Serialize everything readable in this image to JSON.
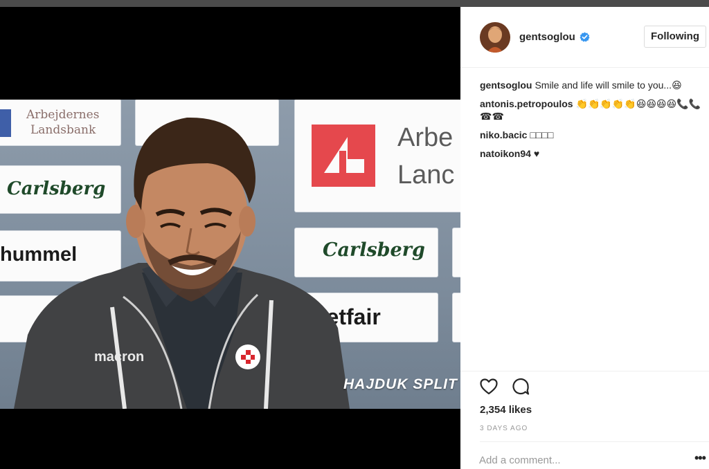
{
  "post": {
    "username": "gentsoglou",
    "follow_label": "Following",
    "likes_text": "2,354 likes",
    "date_text": "3 DAYS AGO",
    "comment_placeholder": "Add a comment...",
    "more_label": "•••"
  },
  "comments": [
    {
      "user": "gentsoglou",
      "text": "Smile and life will smile to you...😆"
    },
    {
      "user": "antonis.petropoulos",
      "text": "👏👏👏👏👏😆😆😆😆📞📞☎☎"
    },
    {
      "user": "niko.bacic",
      "text": "□□□□"
    },
    {
      "user": "natoikon94",
      "text": "♥"
    }
  ],
  "media": {
    "sponsor_1": "Arbejdernes",
    "sponsor_1b": "Landsbank",
    "sponsor_2": "Carlsberg",
    "sponsor_3": "hummel",
    "sponsor_4": "Arbe",
    "sponsor_4b": "Lanc",
    "sponsor_5": "Carlsberg",
    "sponsor_6": "betfair",
    "overlay_text": "HAJDUK SPLIT",
    "jersey_brand": "macron"
  },
  "icons": {
    "verified": "verified-badge-icon",
    "like": "heart-outline-icon",
    "comment": "comment-bubble-icon",
    "more": "more-options-icon"
  },
  "colors": {
    "verified": "#3897f0",
    "text": "#262626",
    "muted": "#999999",
    "sponsor_red": "#e5484d"
  }
}
